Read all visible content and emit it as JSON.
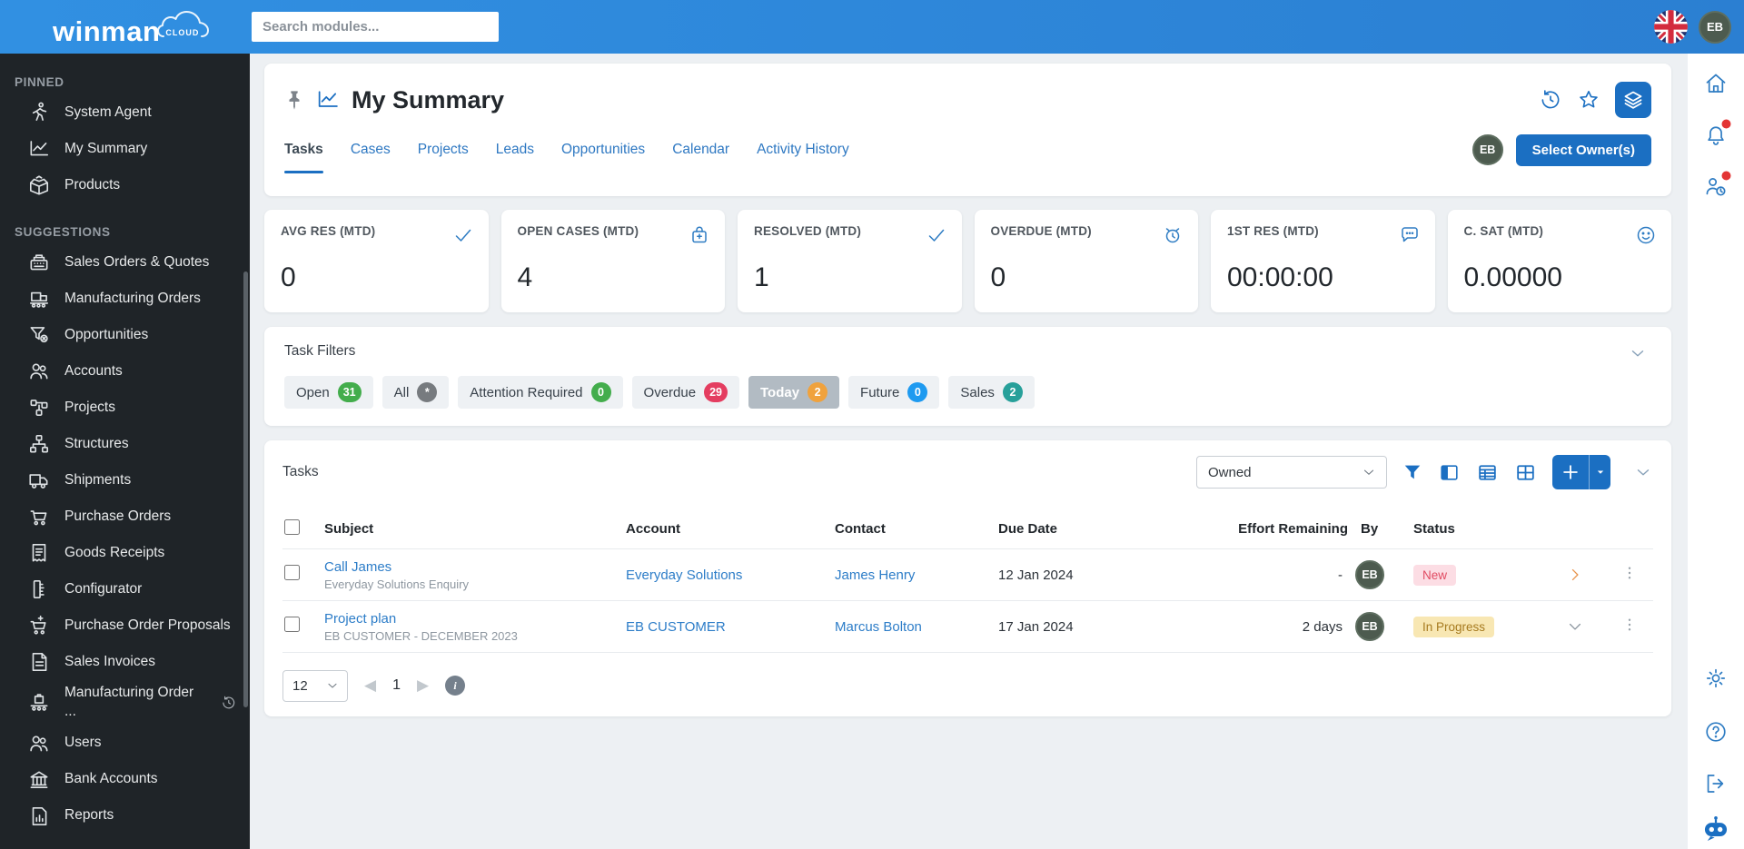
{
  "topbar": {
    "logo_text": "winman",
    "logo_badge": "CLOUD",
    "search_placeholder": "Search modules...",
    "user_initials": "EB"
  },
  "sidebar": {
    "sections": [
      {
        "title": "PINNED",
        "items": [
          {
            "label": "System Agent",
            "icon": "running-person-icon"
          },
          {
            "label": "My Summary",
            "icon": "line-chart-icon"
          },
          {
            "label": "Products",
            "icon": "open-box-icon"
          }
        ]
      },
      {
        "title": "SUGGESTIONS",
        "items": [
          {
            "label": "Sales Orders & Quotes",
            "icon": "cash-register-icon"
          },
          {
            "label": "Manufacturing Orders",
            "icon": "factory-machine-icon"
          },
          {
            "label": "Opportunities",
            "icon": "funnel-x-icon"
          },
          {
            "label": "Accounts",
            "icon": "people-icon"
          },
          {
            "label": "Projects",
            "icon": "nodes-icon"
          },
          {
            "label": "Structures",
            "icon": "hierarchy-icon"
          },
          {
            "label": "Shipments",
            "icon": "truck-icon"
          },
          {
            "label": "Purchase Orders",
            "icon": "cart-icon"
          },
          {
            "label": "Goods Receipts",
            "icon": "receipt-icon"
          },
          {
            "label": "Configurator",
            "icon": "ruler-icon"
          },
          {
            "label": "Purchase Order Proposals",
            "icon": "cart-plus-icon"
          },
          {
            "label": "Sales Invoices",
            "icon": "invoice-icon"
          },
          {
            "label": "Manufacturing Order ...",
            "icon": "conveyor-icon",
            "trailing_icon": "history-icon"
          },
          {
            "label": "Users",
            "icon": "people-icon"
          },
          {
            "label": "Bank Accounts",
            "icon": "bank-icon"
          },
          {
            "label": "Reports",
            "icon": "report-icon"
          }
        ]
      }
    ]
  },
  "page": {
    "title": "My Summary",
    "tabs": [
      {
        "label": "Tasks",
        "active": true
      },
      {
        "label": "Cases",
        "active": false
      },
      {
        "label": "Projects",
        "active": false
      },
      {
        "label": "Leads",
        "active": false
      },
      {
        "label": "Opportunities",
        "active": false
      },
      {
        "label": "Calendar",
        "active": false
      },
      {
        "label": "Activity History",
        "active": false
      }
    ],
    "owner_initials": "EB",
    "select_owners_label": "Select Owner(s)"
  },
  "stats": [
    {
      "label": "AVG RES (MTD)",
      "value": "0",
      "icon": "check-icon"
    },
    {
      "label": "OPEN CASES (MTD)",
      "value": "4",
      "icon": "case-icon"
    },
    {
      "label": "RESOLVED (MTD)",
      "value": "1",
      "icon": "check-icon"
    },
    {
      "label": "OVERDUE (MTD)",
      "value": "0",
      "icon": "alarm-clock-icon"
    },
    {
      "label": "1ST RES (MTD)",
      "value": "00:00:00",
      "icon": "chat-bubble-icon"
    },
    {
      "label": "C. SAT (MTD)",
      "value": "0.00000",
      "icon": "smiley-icon"
    }
  ],
  "task_filters": {
    "title": "Task Filters",
    "chips": [
      {
        "label": "Open",
        "count": "31",
        "badge_color": "#43ad4c",
        "active": false
      },
      {
        "label": "All",
        "count": "*",
        "badge_color": "#777b7f",
        "active": false
      },
      {
        "label": "Attention Required",
        "count": "0",
        "badge_color": "#43ad4c",
        "active": false
      },
      {
        "label": "Overdue",
        "count": "29",
        "badge_color": "#e43d60",
        "active": false
      },
      {
        "label": "Today",
        "count": "2",
        "badge_color": "#f0a23d",
        "active": true
      },
      {
        "label": "Future",
        "count": "0",
        "badge_color": "#1e9af0",
        "active": false
      },
      {
        "label": "Sales",
        "count": "2",
        "badge_color": "#27a09a",
        "active": false
      }
    ]
  },
  "tasks": {
    "title": "Tasks",
    "scope_select_value": "Owned",
    "columns": [
      "Subject",
      "Account",
      "Contact",
      "Due Date",
      "Effort Remaining",
      "By",
      "Status"
    ],
    "rows": [
      {
        "subject": "Call James",
        "subtitle": "Everyday Solutions Enquiry",
        "account": "Everyday Solutions",
        "contact": "James Henry",
        "due_date": "12 Jan 2024",
        "effort_remaining": "-",
        "by_initials": "EB",
        "status": "New",
        "status_bg": "#fcdde4",
        "status_text_color": "#e14b62"
      },
      {
        "subject": "Project plan",
        "subtitle": "EB CUSTOMER - DECEMBER 2023",
        "account": "EB CUSTOMER",
        "contact": "Marcus Bolton",
        "due_date": "17 Jan 2024",
        "effort_remaining": "2 days",
        "by_initials": "EB",
        "status": "In Progress",
        "status_bg": "#f8e7b3",
        "status_text_color": "#a67a1f"
      }
    ],
    "pagination": {
      "page_size": "12",
      "current_page": "1"
    }
  },
  "colors": {
    "topbar_blue": "#2e87da",
    "sidebar_bg": "#1f2428",
    "accent_blue": "#1b6fc2",
    "page_bg": "#edf0f3",
    "avatar_green": "#4d5b4f",
    "badge_green": "#43ad4c",
    "badge_red": "#e43d60",
    "badge_orange": "#f0a23d",
    "badge_blue": "#1e9af0",
    "badge_teal": "#27a09a",
    "notification_dot": "#e33434"
  }
}
